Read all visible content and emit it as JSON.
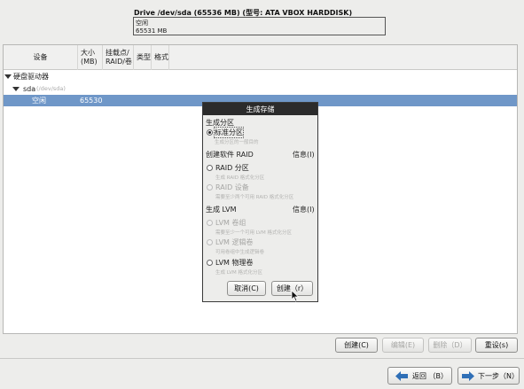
{
  "drive": {
    "title": "Drive /dev/sda (65536 MB) (型号: ATA VBOX HARDDISK)",
    "segment_label": "空闲",
    "segment_size": "65531 MB"
  },
  "table": {
    "headers": [
      "设备",
      "大小\n(MB)",
      "挂载点/\nRAID/卷",
      "类型",
      "格式"
    ],
    "rows": {
      "group": "硬盘驱动器",
      "disk_name": "sda",
      "disk_path": "(/dev/sda)",
      "free_label": "空闲",
      "free_size": "65530"
    }
  },
  "dialog": {
    "title": "生成存储",
    "sec1": "生成分区",
    "std_label": "标准分区",
    "std_hint": "生成分区的一般目的",
    "sec2": "创建软件 RAID",
    "info2": "信息(I)",
    "raid_part": "RAID 分区",
    "raid_part_hint": "生成 RAID 格式化分区",
    "raid_dev": "RAID 设备",
    "raid_dev_hint": "需要至少两个可用 RAID 格式化分区",
    "sec3": "生成 LVM",
    "info3": "信息(I)",
    "lvm_vg": "LVM 卷组",
    "lvm_vg_hint": "需要至少一个可用 LVM 格式化分区",
    "lvm_lv": "LVM 逻辑卷",
    "lvm_lv_hint": "可用卷组中生成逻辑卷",
    "lvm_pv": "LVM 物理卷",
    "lvm_pv_hint": "生成 LVM 格式化分区",
    "cancel": "取消(C)",
    "create": "创建（r）"
  },
  "buttons": {
    "create": "创建(C)",
    "edit": "编辑(E)",
    "delete": "删除（D）",
    "reset": "重设(s)",
    "back": "返回 （B）",
    "next": "下一步（N）"
  },
  "colors": {
    "selection": "#6f97c8",
    "dialog_title_bg": "#2b2b2b",
    "back_arrow": "#2f6fb6",
    "next_arrow": "#2f6fb6"
  }
}
